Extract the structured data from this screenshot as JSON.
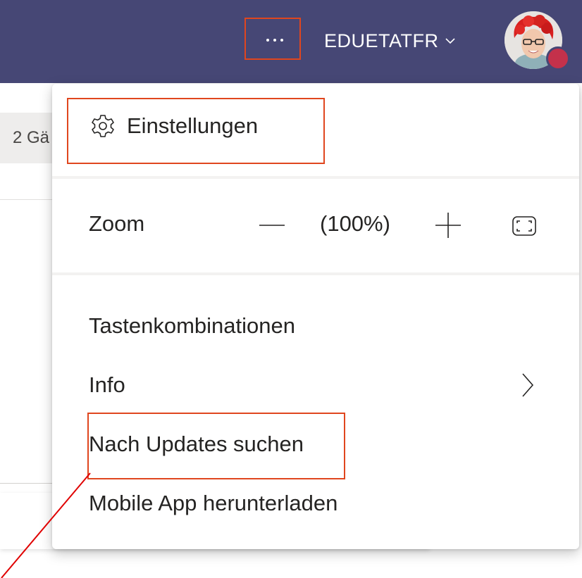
{
  "topbar": {
    "user_name": "EDUETATFR",
    "background": "#464775",
    "more_icon": "ellipsis-icon",
    "presence_color": "#c4314b"
  },
  "background_content": {
    "pill_text": "2 Gä"
  },
  "menu": {
    "settings_label": "Einstellungen",
    "settings_icon": "gear-icon",
    "zoom_label": "Zoom",
    "zoom_value": "(100%)",
    "items": [
      {
        "label": "Tastenkombinationen"
      },
      {
        "label": "Info",
        "has_submenu": true
      },
      {
        "label": "Nach Updates suchen"
      },
      {
        "label": "Mobile App herunterladen"
      }
    ]
  },
  "annotations": {
    "highlight_color": "#e0461e",
    "arrow_color": "#e00000"
  }
}
